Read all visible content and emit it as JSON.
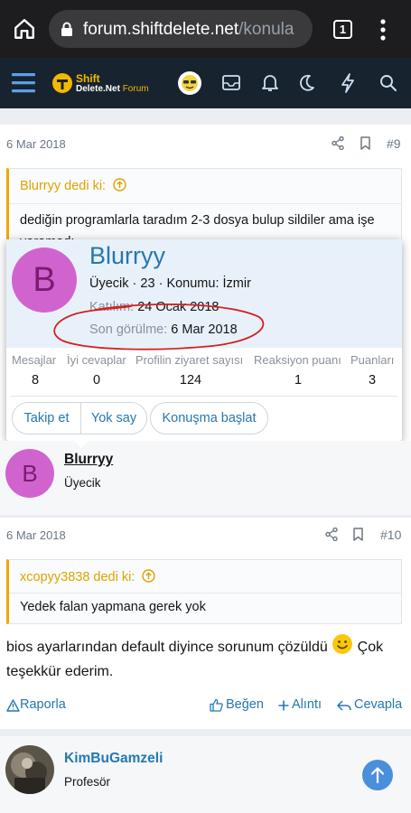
{
  "browser": {
    "url_host": "forum.shiftdelete.net",
    "url_path": "/konula",
    "tab_count": "1"
  },
  "site": {
    "logo_top": "Shift",
    "logo_bottom_a": "Delete",
    "logo_bottom_b": ".Net",
    "logo_bottom_c": " Forum"
  },
  "post9": {
    "date": "6 Mar 2018",
    "number": "#9",
    "quote_author": "Blurryy dedi ki:",
    "quote_text": "dediğin programlarla taradım 2-3 dosya bulup sildiler ama işe yaramadı"
  },
  "popup": {
    "avatar_letter": "B",
    "name": "Blurryy",
    "role": "Üyecik",
    "sep1": " · ",
    "age": "23",
    "sep2": " · ",
    "location_label": "Konumu: ",
    "location": "İzmir",
    "joined_label": "Katılım: ",
    "joined": "24 Ocak 2018",
    "seen_label": "Son görülme: ",
    "seen": "6 Mar 2018",
    "stats": [
      {
        "label": "Mesajlar",
        "value": "8"
      },
      {
        "label": "İyi cevaplar",
        "value": "0"
      },
      {
        "label": "Profilin ziyaret sayısı",
        "value": "124"
      },
      {
        "label": "Reaksiyon puanı",
        "value": "1"
      },
      {
        "label": "Puanları",
        "value": "3"
      }
    ],
    "follow_label": "Takip et",
    "ignore_label": "Yok say",
    "conversation_label": "Konuşma başlat"
  },
  "author_blurryy": {
    "avatar_letter": "B",
    "name": "Blurryy",
    "role": "Üyecik"
  },
  "post10": {
    "date": "6 Mar 2018",
    "number": "#10",
    "quote_author": "xcopyy3838 dedi ki:",
    "quote_text": "Yedek falan yapmana gerek yok",
    "text_part1": "bios ayarlarından default diyince sorunum çözüldü ",
    "text_part2": " Çok teşekkür ederim.",
    "report_label": "Raporla",
    "like_label": "Beğen",
    "quote_label": "Alıntı",
    "reply_label": "Cevapla"
  },
  "author_next": {
    "name": "KimBuGamzeli",
    "role": "Profesör"
  },
  "colors": {
    "accent": "#2577b1",
    "header_bg": "#17242f",
    "quote_accent": "#f0a800",
    "avatar_bg": "#d163cf",
    "annotation_red": "#d42020"
  },
  "icons": [
    "home-icon",
    "lock-icon",
    "tab-switcher-icon",
    "more-vert-icon",
    "hamburger-menu-icon",
    "avatar-icon",
    "mail-icon",
    "bell-icon",
    "moon-icon",
    "bolt-icon",
    "search-icon",
    "share-icon",
    "bookmark-icon",
    "arrow-up-circle-icon",
    "warning-icon",
    "thumbs-up-icon",
    "plus-icon",
    "reply-icon",
    "smiley-emoji-icon",
    "scroll-top-icon"
  ]
}
